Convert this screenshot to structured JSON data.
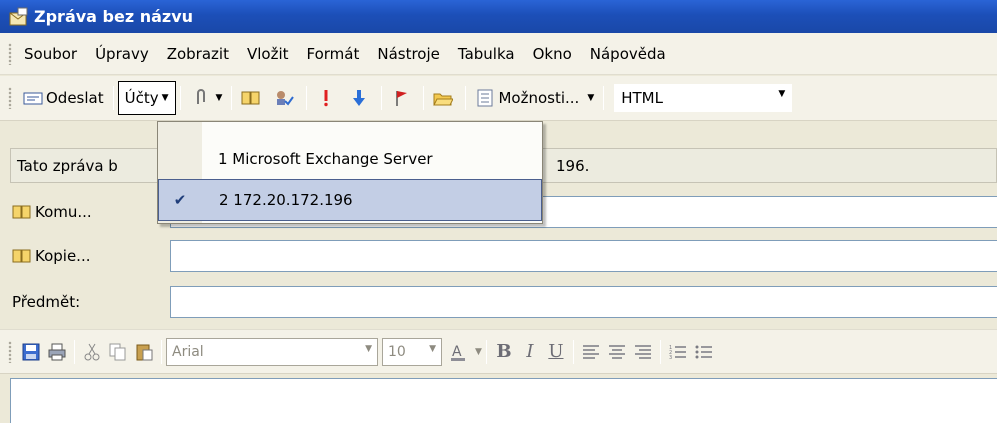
{
  "window": {
    "title": "Zpráva bez názvu"
  },
  "menubar": {
    "items": [
      {
        "label": "Soubor"
      },
      {
        "label": "Úpravy"
      },
      {
        "label": "Zobrazit"
      },
      {
        "label": "Vložit"
      },
      {
        "label": "Formát"
      },
      {
        "label": "Nástroje"
      },
      {
        "label": "Tabulka"
      },
      {
        "label": "Okno"
      },
      {
        "label": "Nápověda"
      }
    ]
  },
  "toolbar": {
    "send_label": "Odeslat",
    "accounts_label": "Účty",
    "options_label": "Možnosti...",
    "format_value": "HTML"
  },
  "infobar": {
    "text_start": "Tato zpráva b",
    "text_end": "196."
  },
  "accounts_menu": {
    "items": [
      {
        "label": "1 Microsoft Exchange Server",
        "checked": false
      },
      {
        "label": "2 172.20.172.196",
        "checked": true
      }
    ]
  },
  "fields": {
    "to_label": "Komu...",
    "cc_label": "Kopie...",
    "subject_label": "Předmět:"
  },
  "format_toolbar": {
    "font": "Arial",
    "size": "10"
  },
  "colors": {
    "title_bar": "#1c4fb8",
    "selection": "#c3cee5",
    "toolbar": "#f4f2e8"
  }
}
